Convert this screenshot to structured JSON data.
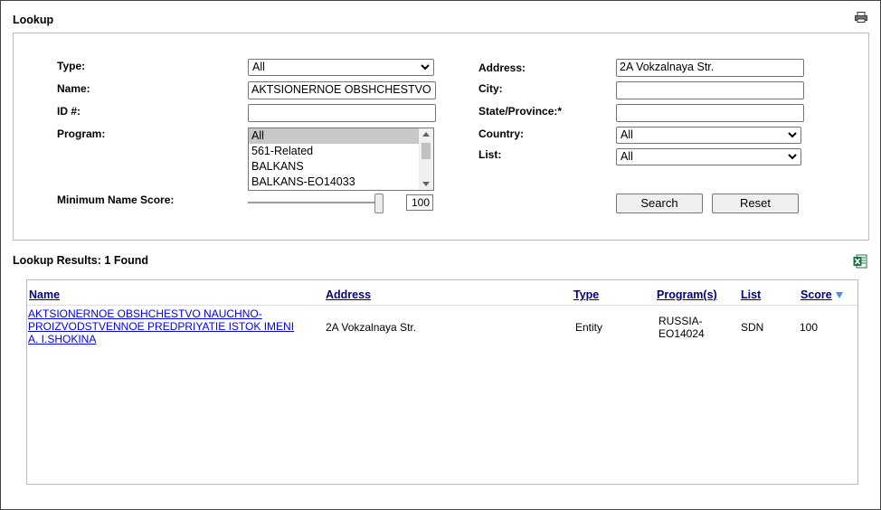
{
  "lookup": {
    "title": "Lookup",
    "type_label": "Type:",
    "type_value": "All",
    "name_label": "Name:",
    "name_value": "AKTSIONERNOE OBSHCHESTVO",
    "id_label": "ID #:",
    "id_value": "",
    "program_label": "Program:",
    "program_options": [
      "All",
      "561-Related",
      "BALKANS",
      "BALKANS-EO14033"
    ],
    "program_selected": "All",
    "min_score_label": "Minimum Name Score:",
    "min_score_value": "100",
    "address_label": "Address:",
    "address_value": "2A Vokzalnaya Str.",
    "city_label": "City:",
    "city_value": "",
    "state_label": "State/Province:*",
    "state_value": "",
    "country_label": "Country:",
    "country_value": "All",
    "list_label": "List:",
    "list_value": "All",
    "search_button": "Search",
    "reset_button": "Reset"
  },
  "results": {
    "title": "Lookup Results: 1 Found",
    "columns": [
      "Name",
      "Address",
      "Type",
      "Program(s)",
      "List",
      "Score"
    ],
    "rows": [
      {
        "name_lines": [
          "AKTSIONERNOE OBSHCHESTVO NAUCHNO-",
          "PROIZVODSTVENNOE PREDPRIYATIE ISTOK IMENI",
          "A. I.SHOKINA"
        ],
        "address": "2A Vokzalnaya Str.",
        "type": "Entity",
        "program_lines": [
          "RUSSIA-",
          "EO14024"
        ],
        "list": "SDN",
        "score": "100"
      }
    ]
  },
  "icons": {
    "print": "print-icon",
    "excel": "excel-export-icon",
    "sort": "sort-desc-icon"
  }
}
